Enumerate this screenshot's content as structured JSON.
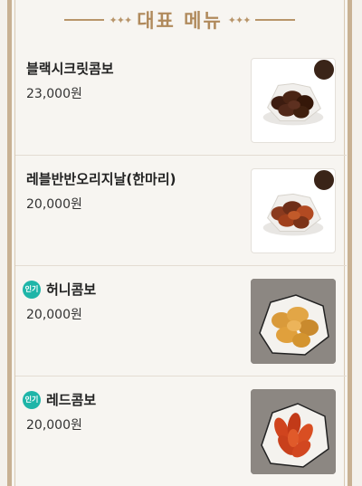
{
  "header": {
    "title": "대표 메뉴"
  },
  "items": [
    {
      "name": "블랙시크릿콤보",
      "price": "23,000원",
      "badge": "",
      "image": "black-secret-chicken"
    },
    {
      "name": "레블반반오리지날(한마리)",
      "price": "20,000원",
      "badge": "",
      "image": "half-half-chicken"
    },
    {
      "name": "허니콤보",
      "price": "20,000원",
      "badge": "인기",
      "image": "honey-chicken"
    },
    {
      "name": "레드콤보",
      "price": "20,000원",
      "badge": "인기",
      "image": "red-chicken"
    }
  ]
}
